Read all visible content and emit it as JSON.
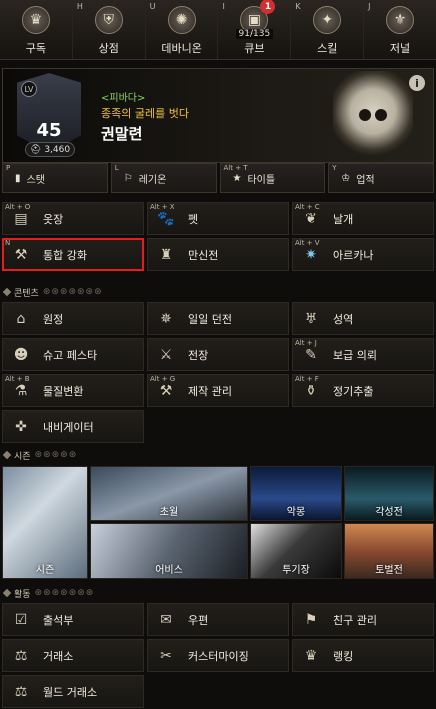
{
  "topbar": [
    {
      "key": "",
      "label": "구독",
      "icon": "crown-emblem-icon"
    },
    {
      "key": "H",
      "label": "상점",
      "icon": "shop-icon"
    },
    {
      "key": "U",
      "label": "데바니온",
      "icon": "daevanion-icon"
    },
    {
      "key": "I",
      "label": "큐브",
      "icon": "cube-icon",
      "count": "91/135",
      "badge": "1"
    },
    {
      "key": "K",
      "label": "스킬",
      "icon": "skill-book-icon"
    },
    {
      "key": "J",
      "label": "저널",
      "icon": "journal-icon"
    }
  ],
  "profile": {
    "lv_label": "LV",
    "level": "45",
    "item_level": "3,460",
    "title_tag": "<피바다>",
    "title_text": "종족의 굴레를 벗다",
    "name": "권말련",
    "info": "i"
  },
  "subtabs": [
    {
      "key": "P",
      "label": "스탯",
      "icon": "stats-icon"
    },
    {
      "key": "L",
      "label": "레기온",
      "icon": "legion-icon"
    },
    {
      "key": "Alt + T",
      "label": "타이틀",
      "icon": "title-icon"
    },
    {
      "key": "Y",
      "label": "업적",
      "icon": "achievement-icon"
    }
  ],
  "grid1": [
    {
      "key": "Alt + O",
      "label": "옷장",
      "icon": "wardrobe-icon"
    },
    {
      "key": "Alt + X",
      "label": "펫",
      "icon": "pet-icon"
    },
    {
      "key": "Alt + C",
      "label": "날개",
      "icon": "wings-icon"
    },
    {
      "key": "N",
      "label": "통합 강화",
      "icon": "anvil-icon",
      "highlight": true
    },
    {
      "key": "",
      "label": "만신전",
      "icon": "pantheon-icon"
    },
    {
      "key": "Alt + V",
      "label": "아르카나",
      "icon": "arcana-icon"
    }
  ],
  "section_contents": "콘텐츠",
  "grid2": [
    {
      "key": "",
      "label": "원정",
      "icon": "portal-icon"
    },
    {
      "key": "",
      "label": "일일 던전",
      "icon": "daily-dungeon-icon"
    },
    {
      "key": "",
      "label": "성역",
      "icon": "sanctuary-icon"
    },
    {
      "key": "",
      "label": "슈고 페스타",
      "icon": "shugo-icon"
    },
    {
      "key": "",
      "label": "전장",
      "icon": "crossed-swords-icon"
    },
    {
      "key": "Alt + J",
      "label": "보급 의뢰",
      "icon": "supply-quill-icon"
    },
    {
      "key": "Alt + B",
      "label": "물질변환",
      "icon": "transmute-icon"
    },
    {
      "key": "Alt + G",
      "label": "제작 관리",
      "icon": "crafting-icon"
    },
    {
      "key": "Alt + F",
      "label": "정기추출",
      "icon": "extraction-icon"
    },
    {
      "key": "",
      "label": "내비게이터",
      "icon": "navigator-icon"
    }
  ],
  "section_season": "시즌",
  "season": {
    "big": "시즌",
    "items": [
      "초월",
      "악몽",
      "각성전",
      "어비스",
      "투기장",
      "토벌전"
    ]
  },
  "section_activity": "활동",
  "grid3": [
    {
      "key": "",
      "label": "출석부",
      "icon": "attendance-icon"
    },
    {
      "key": "",
      "label": "우편",
      "icon": "mail-icon"
    },
    {
      "key": "",
      "label": "친구 관리",
      "icon": "friends-icon"
    },
    {
      "key": "",
      "label": "거래소",
      "icon": "scales-icon"
    },
    {
      "key": "",
      "label": "커스터마이징",
      "icon": "customize-icon"
    },
    {
      "key": "",
      "label": "랭킹",
      "icon": "ranking-icon"
    },
    {
      "key": "",
      "label": "월드 거래소",
      "icon": "world-market-icon"
    }
  ],
  "colors": {
    "highlight": "#e41e1e",
    "title_green": "#8ed06a",
    "title_gold": "#f0c44a",
    "badge_red": "#d23030"
  }
}
